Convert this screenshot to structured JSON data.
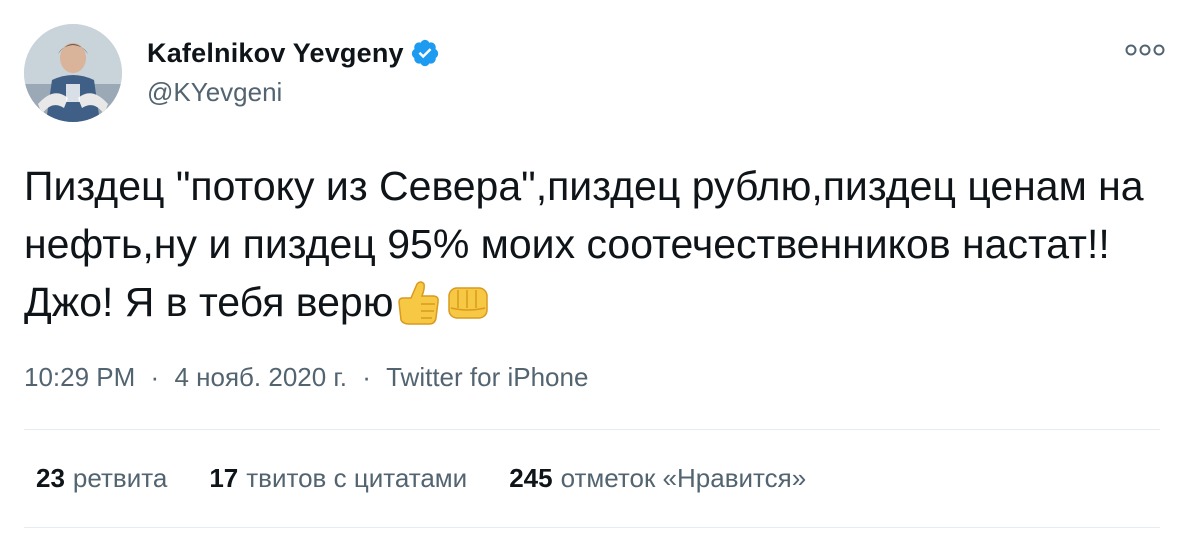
{
  "author": {
    "display_name": "Kafelnikov Yevgeny",
    "handle": "@KYevgeni",
    "verified": true,
    "avatar_icon": "profile-photo-icon",
    "verified_icon": "verified-badge-icon"
  },
  "tweet": {
    "text": "Пиздец \"потоку из Севера\",пиздец рублю,пиздец ценам на нефть,ну и пиздец 95% моих соотечественников настат!! Джо! Я в тебя верю",
    "emojis": [
      "thumbs-up-emoji",
      "raised-fist-emoji"
    ]
  },
  "meta": {
    "time": "10:29 PM",
    "date": "4 нояб. 2020 г.",
    "source": "Twitter for iPhone",
    "separator": "·"
  },
  "stats": {
    "retweets_count": "23",
    "retweets_label": "ретвита",
    "quotes_count": "17",
    "quotes_label": "твитов с цитатами",
    "likes_count": "245",
    "likes_label": "отметок «Нравится»"
  },
  "colors": {
    "text_primary": "#0f1419",
    "text_secondary": "#536471",
    "verified_blue": "#1d9bf0",
    "divider": "#e6ecf0"
  },
  "icons": {
    "more": "more-options-icon"
  }
}
